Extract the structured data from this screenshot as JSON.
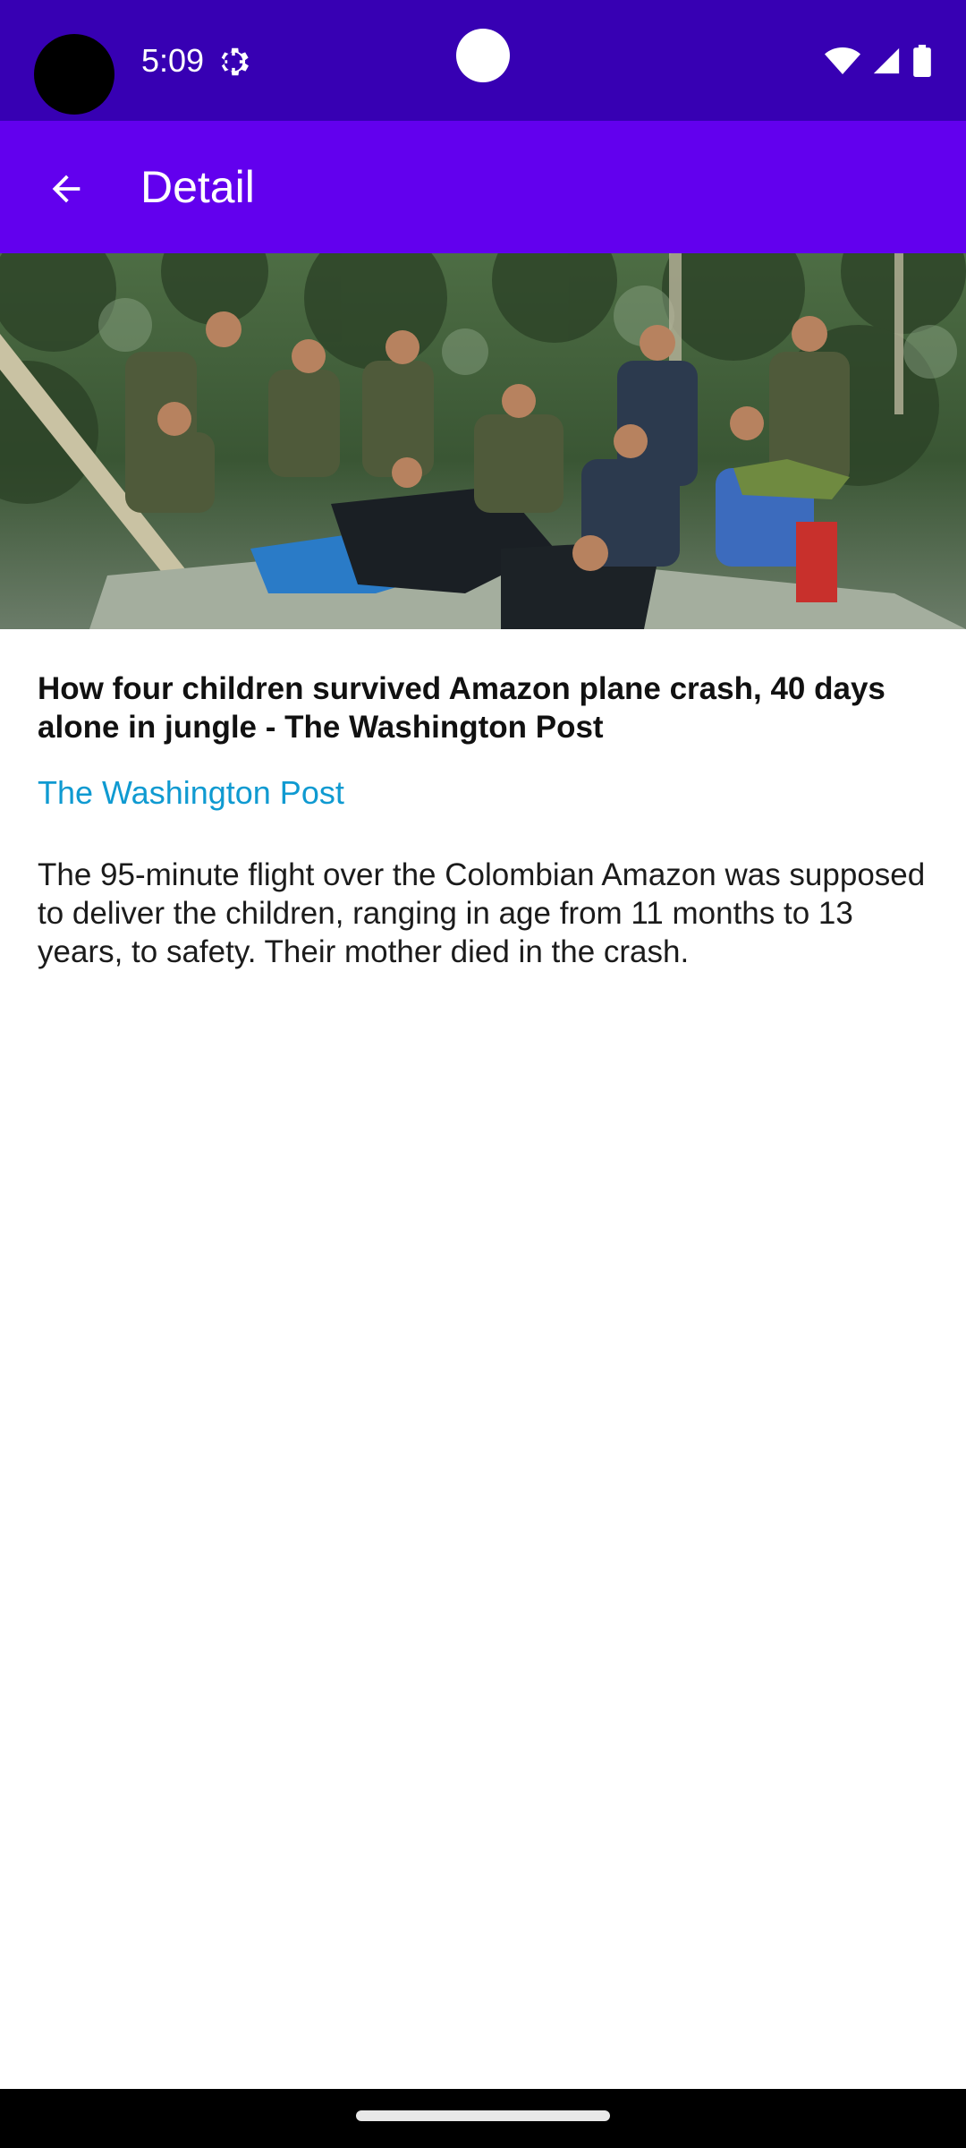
{
  "status_bar": {
    "time": "5:09",
    "settings_icon": "gear-icon",
    "wifi_icon": "wifi-icon",
    "signal_icon": "signal-icon",
    "battery_icon": "battery-icon",
    "background_color": "#3700B3"
  },
  "app_bar": {
    "title": "Detail",
    "back_icon": "arrow-back-icon",
    "background_color": "#6200EE"
  },
  "article": {
    "image_description_icon": "article-photo",
    "headline": "How four children survived Amazon plane crash, 40 days alone in jungle - The Washington Post",
    "source": "The Washington Post",
    "source_color": "#0f9ad1",
    "summary": "The 95-minute flight over the Colombian Amazon was supposed to deliver the children, ranging in age from 11 months to 13 years, to safety. Their mother died in the crash."
  },
  "nav_bar": {
    "handle": "home-handle"
  }
}
